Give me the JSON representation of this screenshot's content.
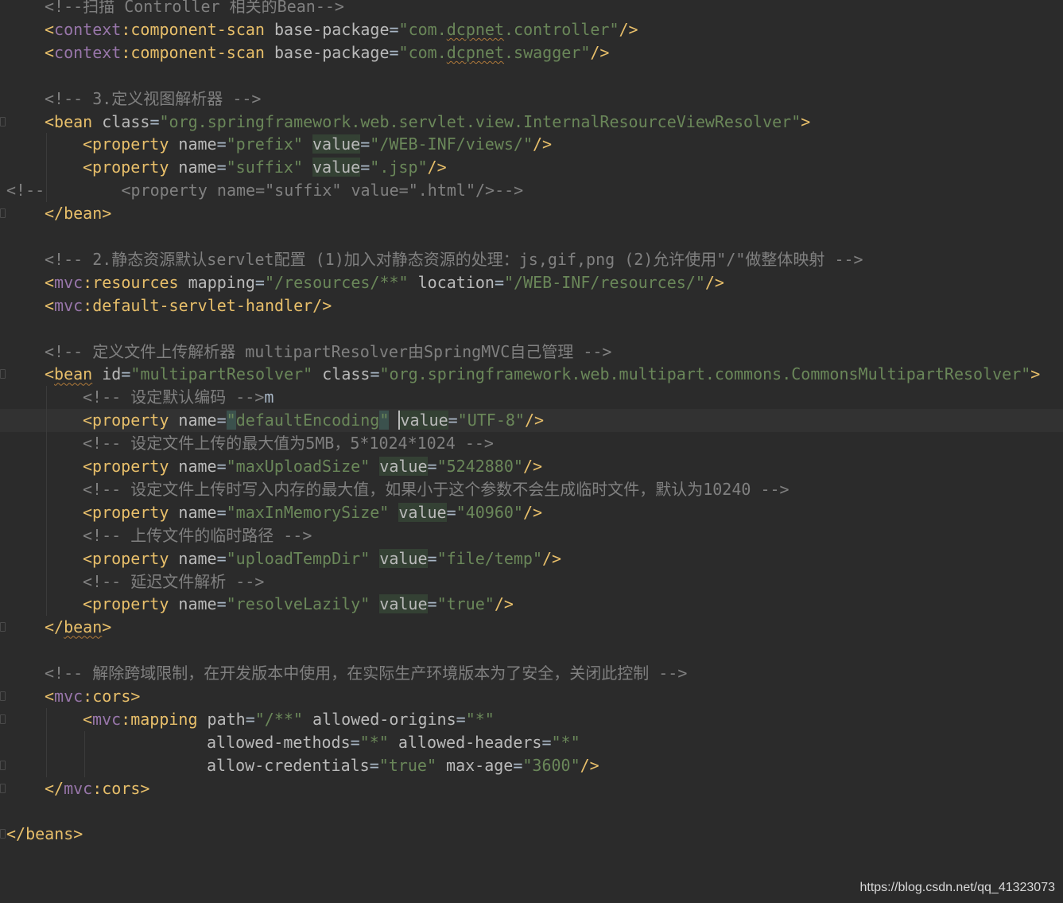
{
  "editor": {
    "lines": [
      {
        "indent": 1,
        "gutter": false,
        "segs": [
          [
            "c",
            "<!--扫描 Controller 相关的Bean-->"
          ]
        ]
      },
      {
        "indent": 1,
        "gutter": false,
        "segs": [
          [
            "t",
            "<"
          ],
          [
            "ns",
            "context"
          ],
          [
            "t",
            ":component-scan "
          ],
          [
            "a",
            "base-package"
          ],
          [
            "p",
            "="
          ],
          [
            "v",
            "\"com."
          ],
          [
            "vsq",
            "dcpnet"
          ],
          [
            "v",
            ".controller\""
          ],
          [
            "t",
            "/>"
          ]
        ]
      },
      {
        "indent": 1,
        "gutter": false,
        "segs": [
          [
            "t",
            "<"
          ],
          [
            "ns",
            "context"
          ],
          [
            "t",
            ":component-scan "
          ],
          [
            "a",
            "base-package"
          ],
          [
            "p",
            "="
          ],
          [
            "v",
            "\"com."
          ],
          [
            "vsq",
            "dcpnet"
          ],
          [
            "v",
            ".swagger\""
          ],
          [
            "t",
            "/>"
          ]
        ]
      },
      {
        "indent": 0,
        "gutter": false,
        "segs": []
      },
      {
        "indent": 1,
        "gutter": false,
        "segs": [
          [
            "c",
            "<!-- 3.定义视图解析器 -->"
          ]
        ]
      },
      {
        "indent": 1,
        "gutter": true,
        "segs": [
          [
            "t",
            "<bean "
          ],
          [
            "a",
            "class"
          ],
          [
            "p",
            "="
          ],
          [
            "v",
            "\"org.springframework.web.servlet.view.InternalResourceViewResolver\""
          ],
          [
            "t",
            ">"
          ]
        ]
      },
      {
        "indent": 2,
        "gutter": false,
        "segs": [
          [
            "t",
            "<property "
          ],
          [
            "a",
            "name"
          ],
          [
            "p",
            "="
          ],
          [
            "v",
            "\"prefix\" "
          ],
          [
            "ahl",
            "value"
          ],
          [
            "p",
            "="
          ],
          [
            "v",
            "\"/WEB-INF/views/\""
          ],
          [
            "t",
            "/>"
          ]
        ]
      },
      {
        "indent": 2,
        "gutter": false,
        "segs": [
          [
            "t",
            "<property "
          ],
          [
            "a",
            "name"
          ],
          [
            "p",
            "="
          ],
          [
            "v",
            "\"suffix\" "
          ],
          [
            "ahl",
            "value"
          ],
          [
            "p",
            "="
          ],
          [
            "v",
            "\".jsp\""
          ],
          [
            "t",
            "/>"
          ]
        ]
      },
      {
        "indent": 0,
        "gutter": false,
        "segs": [
          [
            "c",
            "<!--        <property name=\"suffix\" value=\".html\"/>-->"
          ]
        ]
      },
      {
        "indent": 1,
        "gutter": true,
        "segs": [
          [
            "t",
            "</bean>"
          ]
        ]
      },
      {
        "indent": 0,
        "gutter": false,
        "segs": []
      },
      {
        "indent": 1,
        "gutter": false,
        "segs": [
          [
            "c",
            "<!-- 2.静态资源默认servlet配置 (1)加入对静态资源的处理：js,gif,png (2)允许使用\"/\"做整体映射 -->"
          ]
        ]
      },
      {
        "indent": 1,
        "gutter": false,
        "segs": [
          [
            "t",
            "<"
          ],
          [
            "ns",
            "mvc"
          ],
          [
            "t",
            ":resources "
          ],
          [
            "a",
            "mapping"
          ],
          [
            "p",
            "="
          ],
          [
            "v",
            "\"/resources/**\" "
          ],
          [
            "a",
            "location"
          ],
          [
            "p",
            "="
          ],
          [
            "v",
            "\"/WEB-INF/resources/\""
          ],
          [
            "t",
            "/>"
          ]
        ]
      },
      {
        "indent": 1,
        "gutter": false,
        "segs": [
          [
            "t",
            "<"
          ],
          [
            "ns",
            "mvc"
          ],
          [
            "t",
            ":default-servlet-handler/>"
          ]
        ]
      },
      {
        "indent": 0,
        "gutter": false,
        "segs": []
      },
      {
        "indent": 1,
        "gutter": false,
        "segs": [
          [
            "c",
            "<!-- 定义文件上传解析器 multipartResolver由SpringMVC自己管理 -->"
          ]
        ]
      },
      {
        "indent": 1,
        "gutter": true,
        "segs": [
          [
            "t",
            "<"
          ],
          [
            "tsq",
            "bean"
          ],
          [
            "t",
            " "
          ],
          [
            "a",
            "id"
          ],
          [
            "p",
            "="
          ],
          [
            "v",
            "\"multipartResolver\" "
          ],
          [
            "a",
            "class"
          ],
          [
            "p",
            "="
          ],
          [
            "v",
            "\"org.springframework.web.multipart.commons.CommonsMultipartResolver\""
          ],
          [
            "t",
            ">"
          ]
        ]
      },
      {
        "indent": 2,
        "gutter": false,
        "segs": [
          [
            "c",
            "<!-- 设定默认编码 -->"
          ],
          [
            "p",
            "m"
          ]
        ]
      },
      {
        "indent": 2,
        "gutter": false,
        "current": true,
        "segs": [
          [
            "t",
            "<property "
          ],
          [
            "a",
            "name"
          ],
          [
            "p",
            "="
          ],
          [
            "vmatch",
            "\""
          ],
          [
            "v",
            "defaultEncoding"
          ],
          [
            "vmatch",
            "\""
          ],
          [
            "p",
            " "
          ],
          [
            "acur",
            "v"
          ],
          [
            "ahl",
            "alue"
          ],
          [
            "p",
            "="
          ],
          [
            "v",
            "\"UTF-8\""
          ],
          [
            "t",
            "/>"
          ]
        ]
      },
      {
        "indent": 2,
        "gutter": false,
        "segs": [
          [
            "c",
            "<!-- 设定文件上传的最大值为5MB，5*1024*1024 -->"
          ]
        ]
      },
      {
        "indent": 2,
        "gutter": false,
        "segs": [
          [
            "t",
            "<property "
          ],
          [
            "a",
            "name"
          ],
          [
            "p",
            "="
          ],
          [
            "v",
            "\"maxUploadSize\" "
          ],
          [
            "ahl",
            "value"
          ],
          [
            "p",
            "="
          ],
          [
            "v",
            "\"5242880\""
          ],
          [
            "t",
            "/>"
          ]
        ]
      },
      {
        "indent": 2,
        "gutter": false,
        "segs": [
          [
            "c",
            "<!-- 设定文件上传时写入内存的最大值，如果小于这个参数不会生成临时文件，默认为10240 -->"
          ]
        ]
      },
      {
        "indent": 2,
        "gutter": false,
        "segs": [
          [
            "t",
            "<property "
          ],
          [
            "a",
            "name"
          ],
          [
            "p",
            "="
          ],
          [
            "v",
            "\"maxInMemorySize\" "
          ],
          [
            "ahl",
            "value"
          ],
          [
            "p",
            "="
          ],
          [
            "v",
            "\"40960\""
          ],
          [
            "t",
            "/>"
          ]
        ]
      },
      {
        "indent": 2,
        "gutter": false,
        "segs": [
          [
            "c",
            "<!-- 上传文件的临时路径 -->"
          ]
        ]
      },
      {
        "indent": 2,
        "gutter": false,
        "segs": [
          [
            "t",
            "<property "
          ],
          [
            "a",
            "name"
          ],
          [
            "p",
            "="
          ],
          [
            "v",
            "\"uploadTempDir\" "
          ],
          [
            "ahl",
            "value"
          ],
          [
            "p",
            "="
          ],
          [
            "v",
            "\"file/temp\""
          ],
          [
            "t",
            "/>"
          ]
        ]
      },
      {
        "indent": 2,
        "gutter": false,
        "segs": [
          [
            "c",
            "<!-- 延迟文件解析 -->"
          ]
        ]
      },
      {
        "indent": 2,
        "gutter": false,
        "segs": [
          [
            "t",
            "<property "
          ],
          [
            "a",
            "name"
          ],
          [
            "p",
            "="
          ],
          [
            "v",
            "\"resolveLazily\" "
          ],
          [
            "ahl",
            "value"
          ],
          [
            "p",
            "="
          ],
          [
            "v",
            "\"true\""
          ],
          [
            "t",
            "/>"
          ]
        ]
      },
      {
        "indent": 1,
        "gutter": true,
        "segs": [
          [
            "t",
            "</"
          ],
          [
            "tsq",
            "bean"
          ],
          [
            "t",
            ">"
          ]
        ]
      },
      {
        "indent": 0,
        "gutter": false,
        "segs": []
      },
      {
        "indent": 1,
        "gutter": false,
        "segs": [
          [
            "c",
            "<!-- 解除跨域限制，在开发版本中使用，在实际生产环境版本为了安全，关闭此控制 -->"
          ]
        ]
      },
      {
        "indent": 1,
        "gutter": true,
        "segs": [
          [
            "t",
            "<"
          ],
          [
            "ns",
            "mvc"
          ],
          [
            "t",
            ":cors>"
          ]
        ]
      },
      {
        "indent": 2,
        "gutter": true,
        "segs": [
          [
            "t",
            "<"
          ],
          [
            "ns",
            "mvc"
          ],
          [
            "t",
            ":mapping "
          ],
          [
            "a",
            "path"
          ],
          [
            "p",
            "="
          ],
          [
            "v",
            "\"/**\" "
          ],
          [
            "a",
            "allowed-origins"
          ],
          [
            "p",
            "="
          ],
          [
            "v",
            "\"*\""
          ]
        ]
      },
      {
        "indent": 0,
        "pad": 260,
        "gutter": false,
        "segs": [
          [
            "a",
            "allowed-methods"
          ],
          [
            "p",
            "="
          ],
          [
            "v",
            "\"*\" "
          ],
          [
            "a",
            "allowed-headers"
          ],
          [
            "p",
            "="
          ],
          [
            "v",
            "\"*\""
          ]
        ]
      },
      {
        "indent": 0,
        "pad": 260,
        "gutter": true,
        "segs": [
          [
            "a",
            "allow-credentials"
          ],
          [
            "p",
            "="
          ],
          [
            "v",
            "\"true\" "
          ],
          [
            "a",
            "max-age"
          ],
          [
            "p",
            "="
          ],
          [
            "v",
            "\"3600\""
          ],
          [
            "t",
            "/>"
          ]
        ]
      },
      {
        "indent": 1,
        "gutter": true,
        "segs": [
          [
            "t",
            "</"
          ],
          [
            "ns",
            "mvc"
          ],
          [
            "t",
            ":cors>"
          ]
        ]
      },
      {
        "indent": 0,
        "gutter": false,
        "segs": []
      },
      {
        "indent": 0,
        "gutter": true,
        "segs": [
          [
            "t",
            "</beans>"
          ]
        ]
      }
    ]
  },
  "watermark": "https://blog.csdn.net/qq_41323073"
}
